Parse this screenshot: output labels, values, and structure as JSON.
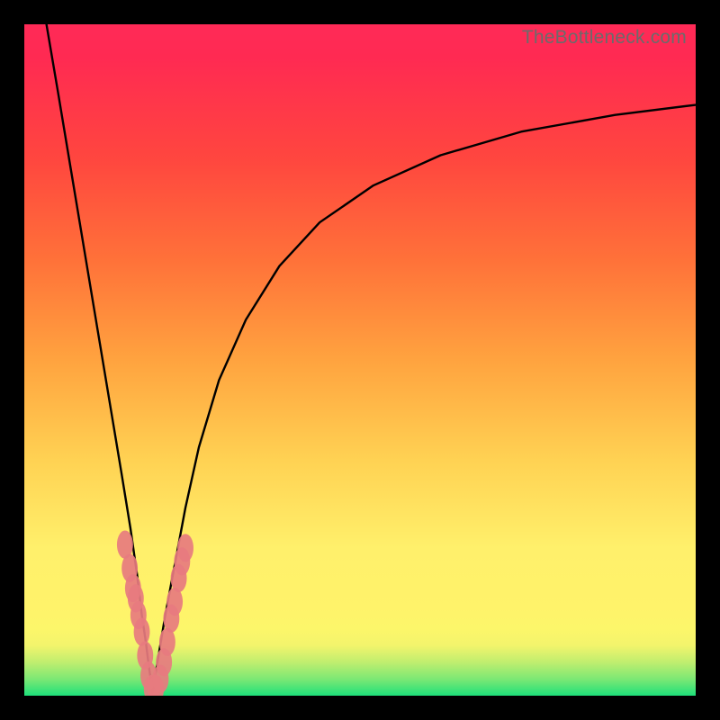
{
  "watermark": "TheBottleneck.com",
  "chart_data": {
    "type": "line",
    "title": "",
    "xlabel": "",
    "ylabel": "",
    "xlim": [
      0,
      100
    ],
    "ylim": [
      0,
      100
    ],
    "background_gradient_stops": [
      {
        "y": 0,
        "color": "#1ee07a"
      },
      {
        "y": 2.5,
        "color": "#7de874"
      },
      {
        "y": 5,
        "color": "#c0ee6f"
      },
      {
        "y": 7.5,
        "color": "#f3f46c"
      },
      {
        "y": 10,
        "color": "#fcf66a"
      },
      {
        "y": 13,
        "color": "#fff36a"
      },
      {
        "y": 22,
        "color": "#fff06b"
      },
      {
        "y": 35,
        "color": "#ffd253"
      },
      {
        "y": 50,
        "color": "#ffa33f"
      },
      {
        "y": 65,
        "color": "#ff7139"
      },
      {
        "y": 80,
        "color": "#ff463f"
      },
      {
        "y": 95,
        "color": "#ff2a52"
      },
      {
        "y": 100,
        "color": "#ff2a57"
      }
    ],
    "series": [
      {
        "name": "left-branch",
        "x": [
          3.3,
          5.0,
          7.0,
          9.0,
          11.0,
          13.0,
          14.5,
          15.8,
          16.8,
          17.5,
          18.1,
          18.6,
          19.1
        ],
        "y": [
          100,
          90,
          78,
          66,
          54,
          42,
          33,
          25,
          18,
          12,
          8,
          4,
          0.5
        ]
      },
      {
        "name": "right-branch",
        "x": [
          19.1,
          20.0,
          21.0,
          22.5,
          24.0,
          26.0,
          29.0,
          33.0,
          38.0,
          44.0,
          52.0,
          62.0,
          74.0,
          88.0,
          100.0
        ],
        "y": [
          0.5,
          6,
          12,
          20,
          28,
          37,
          47,
          56,
          64,
          70.5,
          76,
          80.5,
          84,
          86.5,
          88.0
        ]
      }
    ],
    "scatter_points": {
      "name": "data-points",
      "color": "#e77b7f",
      "rx": 1.2,
      "ry": 2.1,
      "points": [
        {
          "x": 15.0,
          "y": 22.5
        },
        {
          "x": 15.7,
          "y": 19.0
        },
        {
          "x": 16.2,
          "y": 16.0
        },
        {
          "x": 16.6,
          "y": 14.5
        },
        {
          "x": 17.0,
          "y": 12.0
        },
        {
          "x": 17.5,
          "y": 9.5
        },
        {
          "x": 18.0,
          "y": 6.0
        },
        {
          "x": 18.5,
          "y": 3.0
        },
        {
          "x": 19.0,
          "y": 1.0
        },
        {
          "x": 19.6,
          "y": 1.0
        },
        {
          "x": 20.3,
          "y": 2.5
        },
        {
          "x": 20.8,
          "y": 5.0
        },
        {
          "x": 21.3,
          "y": 8.0
        },
        {
          "x": 21.9,
          "y": 11.5
        },
        {
          "x": 22.4,
          "y": 14.0
        },
        {
          "x": 23.0,
          "y": 17.5
        },
        {
          "x": 23.5,
          "y": 20.0
        },
        {
          "x": 24.0,
          "y": 22.0
        }
      ]
    }
  }
}
